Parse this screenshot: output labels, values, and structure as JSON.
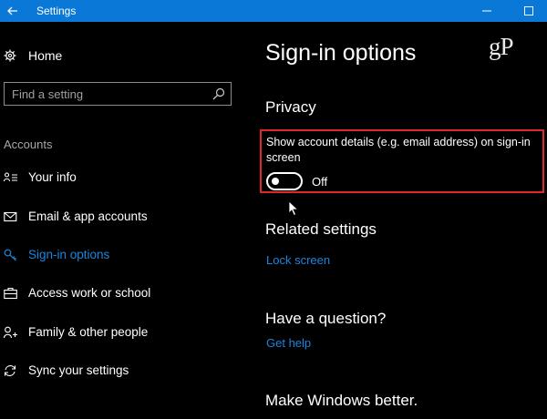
{
  "titlebar": {
    "title": "Settings",
    "bg_color": "#0a78d7"
  },
  "sidebar": {
    "home_label": "Home",
    "search_placeholder": "Find a setting",
    "section_label": "Accounts",
    "items": [
      {
        "label": "Your info",
        "icon": "person-card-icon",
        "active": false
      },
      {
        "label": "Email & app accounts",
        "icon": "mail-icon",
        "active": false
      },
      {
        "label": "Sign-in options",
        "icon": "key-icon",
        "active": true
      },
      {
        "label": "Access work or school",
        "icon": "briefcase-icon",
        "active": false
      },
      {
        "label": "Family & other people",
        "icon": "people-icon",
        "active": false
      },
      {
        "label": "Sync your settings",
        "icon": "sync-icon",
        "active": false
      }
    ],
    "accent_color": "#1a86e0"
  },
  "main": {
    "title": "Sign-in options",
    "logo_text": "gP",
    "privacy": {
      "heading": "Privacy",
      "setting_text": "Show account details (e.g. email address) on sign-in screen",
      "toggle_state": "Off",
      "toggle_on": false
    },
    "related": {
      "heading": "Related settings",
      "link": "Lock screen"
    },
    "question": {
      "heading": "Have a question?",
      "link": "Get help"
    },
    "better": {
      "heading": "Make Windows better."
    },
    "highlight_color": "#e0272c"
  }
}
